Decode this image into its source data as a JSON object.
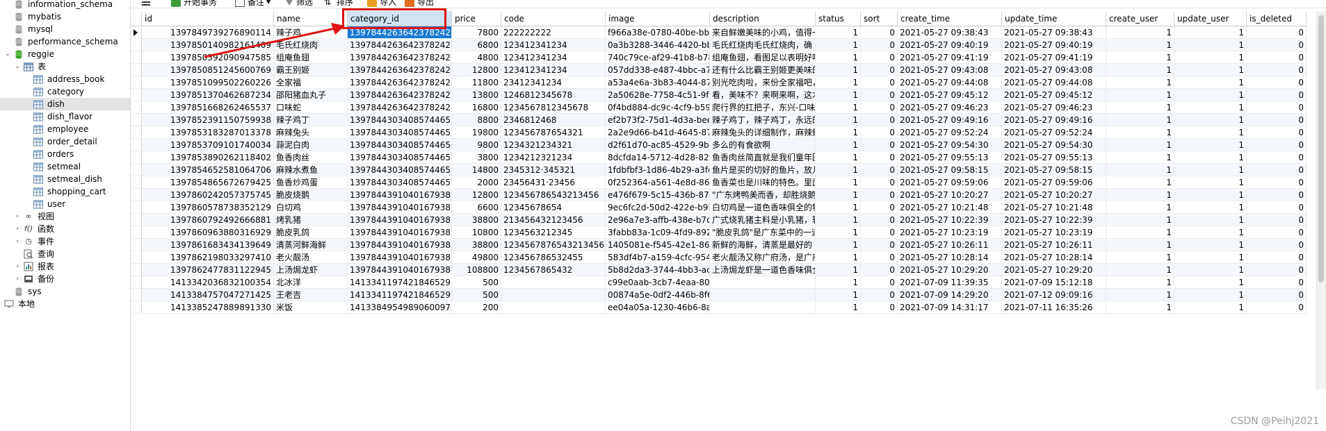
{
  "sidebar": {
    "items": [
      {
        "label": "information_schema",
        "kind": "db",
        "indent": 0,
        "expand": "",
        "open": false
      },
      {
        "label": "mybatis",
        "kind": "db",
        "indent": 0,
        "expand": "",
        "open": false
      },
      {
        "label": "mysql",
        "kind": "db",
        "indent": 0,
        "expand": "",
        "open": false
      },
      {
        "label": "performance_schema",
        "kind": "db",
        "indent": 0,
        "expand": "",
        "open": false
      },
      {
        "label": "reggie",
        "kind": "db",
        "indent": 0,
        "expand": "open",
        "open": true
      },
      {
        "label": "表",
        "kind": "tables",
        "indent": 1,
        "expand": "open",
        "open": true
      },
      {
        "label": "address_book",
        "kind": "table",
        "indent": 2,
        "expand": "",
        "open": false
      },
      {
        "label": "category",
        "kind": "table",
        "indent": 2,
        "expand": "",
        "open": false
      },
      {
        "label": "dish",
        "kind": "table",
        "indent": 2,
        "expand": "",
        "open": false,
        "selected": true
      },
      {
        "label": "dish_flavor",
        "kind": "table",
        "indent": 2,
        "expand": "",
        "open": false
      },
      {
        "label": "employee",
        "kind": "table",
        "indent": 2,
        "expand": "",
        "open": false
      },
      {
        "label": "order_detail",
        "kind": "table",
        "indent": 2,
        "expand": "",
        "open": false
      },
      {
        "label": "orders",
        "kind": "table",
        "indent": 2,
        "expand": "",
        "open": false
      },
      {
        "label": "setmeal",
        "kind": "table",
        "indent": 2,
        "expand": "",
        "open": false
      },
      {
        "label": "setmeal_dish",
        "kind": "table",
        "indent": 2,
        "expand": "",
        "open": false
      },
      {
        "label": "shopping_cart",
        "kind": "table",
        "indent": 2,
        "expand": "",
        "open": false
      },
      {
        "label": "user",
        "kind": "table",
        "indent": 2,
        "expand": "",
        "open": false
      },
      {
        "label": "视图",
        "kind": "views",
        "indent": 1,
        "expand": "closed",
        "open": false
      },
      {
        "label": "函数",
        "kind": "functions",
        "indent": 1,
        "expand": "closed",
        "open": false
      },
      {
        "label": "事件",
        "kind": "events",
        "indent": 1,
        "expand": "closed",
        "open": false
      },
      {
        "label": "查询",
        "kind": "queries",
        "indent": 1,
        "expand": "",
        "open": false
      },
      {
        "label": "报表",
        "kind": "reports",
        "indent": 1,
        "expand": "closed",
        "open": false
      },
      {
        "label": "备份",
        "kind": "backups",
        "indent": 1,
        "expand": "closed",
        "open": false
      },
      {
        "label": "sys",
        "kind": "db",
        "indent": 0,
        "expand": "",
        "open": false
      },
      {
        "label": "本地",
        "kind": "connection",
        "indent": -1,
        "expand": "",
        "open": false
      }
    ]
  },
  "toolbar": {
    "menu_icon": "menu-icon",
    "begin_transaction": "开始事务",
    "note": "备注",
    "filter": "筛选",
    "sort": "排序",
    "import": "导入",
    "export": "导出"
  },
  "grid": {
    "columns": [
      "id",
      "name",
      "category_id",
      "price",
      "code",
      "image",
      "description",
      "status",
      "sort",
      "create_time",
      "update_time",
      "create_user",
      "update_user",
      "is_deleted"
    ],
    "selected_column": "category_id",
    "rows": [
      [
        "1397849739276890114",
        "辣子鸡",
        "1397844263642378242",
        "7800",
        "222222222",
        "f966a38e-0780-40be-bb5",
        "来自鲜嫩美味的小鸡，值得一",
        "1",
        "0",
        "2021-05-27 09:38:43",
        "2021-05-27 09:38:43",
        "1",
        "1",
        "0"
      ],
      [
        "1397850140982161409",
        "毛氏红烧肉",
        "1397844263642378242",
        "6800",
        "123412341234",
        "0a3b3288-3446-4420-bbf",
        "毛氏红烧肉毛氏红烧肉，确",
        "1",
        "0",
        "2021-05-27 09:40:19",
        "2021-05-27 09:40:19",
        "1",
        "1",
        "0"
      ],
      [
        "1397850392090947585",
        "组庵鱼翅",
        "1397844263642378242",
        "4800",
        "123412341234",
        "740c79ce-af29-41b8-b78c",
        "组庵鱼翅，看图足以表明好吃",
        "1",
        "0",
        "2021-05-27 09:41:19",
        "2021-05-27 09:41:19",
        "1",
        "1",
        "0"
      ],
      [
        "1397850851245600769",
        "霸王别姬",
        "1397844263642378242",
        "12800",
        "123412341234",
        "057dd338-e487-4bbc-a74",
        "还有什么比霸王别姬更美味的",
        "1",
        "0",
        "2021-05-27 09:43:08",
        "2021-05-27 09:43:08",
        "1",
        "1",
        "0"
      ],
      [
        "1397851099502260226",
        "全家福",
        "1397844263642378242",
        "11800",
        "23412341234",
        "a53a4e6a-3b83-4044-87f",
        "别光吃肉啦，来份全家福吧，",
        "1",
        "0",
        "2021-05-27 09:44:08",
        "2021-05-27 09:44:08",
        "1",
        "1",
        "0"
      ],
      [
        "1397851370462687234",
        "邵阳猪血丸子",
        "1397844263642378242",
        "13800",
        "1246812345678",
        "2a50628e-7758-4c51-9fbl",
        "看，美味不？来啊来啊，这才",
        "1",
        "0",
        "2021-05-27 09:45:12",
        "2021-05-27 09:45:12",
        "1",
        "1",
        "0"
      ],
      [
        "1397851668262465537",
        "口味蛇",
        "1397844263642378242",
        "16800",
        "1234567812345678",
        "0f4bd884-dc9c-4cf9-b59e",
        "爬行界的扛把子，东兴-口味",
        "1",
        "0",
        "2021-05-27 09:46:23",
        "2021-05-27 09:46:23",
        "1",
        "1",
        "0"
      ],
      [
        "1397852391150759938",
        "辣子鸡丁",
        "1397844303408574465",
        "8800",
        "2346812468",
        "ef2b73f2-75d1-4d3a-beea",
        "辣子鸡丁，辣子鸡丁，永远的",
        "1",
        "0",
        "2021-05-27 09:49:16",
        "2021-05-27 09:49:16",
        "1",
        "1",
        "0"
      ],
      [
        "1397853183287013378",
        "麻辣兔头",
        "1397844303408574465",
        "19800",
        "123456787654321",
        "2a2e9d66-b41d-4645-87b",
        "麻辣兔头的详细制作，麻辣鲜",
        "1",
        "0",
        "2021-05-27 09:52:24",
        "2021-05-27 09:52:24",
        "1",
        "1",
        "0"
      ],
      [
        "1397853709101740034",
        "蒜泥白肉",
        "1397844303408574465",
        "9800",
        "1234321234321",
        "d2f61d70-ac85-4529-9b7",
        "多么的有食欲啊",
        "1",
        "0",
        "2021-05-27 09:54:30",
        "2021-05-27 09:54:30",
        "1",
        "1",
        "0"
      ],
      [
        "1397853890262118402",
        "鱼香肉丝",
        "1397844303408574465",
        "3800",
        "1234212321234",
        "8dcfda14-5712-4d28-82f",
        "鱼香肉丝简直就是我们童年回",
        "1",
        "0",
        "2021-05-27 09:55:13",
        "2021-05-27 09:55:13",
        "1",
        "1",
        "0"
      ],
      [
        "1397854652581064706",
        "麻辣水煮鱼",
        "1397844303408574465",
        "14800",
        "2345312·345321",
        "1fdbfbf3-1d86-4b29-a3fc",
        "鱼片是买的切好的鱼片，放几",
        "1",
        "0",
        "2021-05-27 09:58:15",
        "2021-05-27 09:58:15",
        "1",
        "1",
        "0"
      ],
      [
        "1397854865672679425",
        "鱼香炒鸡蛋",
        "1397844303408574465",
        "2000",
        "23456431·23456",
        "0f252364-a561-4e8d-866",
        "鱼香菜也是川味的特色。里面",
        "1",
        "0",
        "2021-05-27 09:59:06",
        "2021-05-27 09:59:06",
        "1",
        "1",
        "0"
      ],
      [
        "1397860242057375745",
        "脆皮烧鹅",
        "1397844391040167938",
        "12800",
        "123456786543213456",
        "e476f679-5c15-436b-87fa",
        "\"广东烤鸭美而香，却胜烧鹅",
        "1",
        "0",
        "2021-05-27 10:20:27",
        "2021-05-27 10:20:27",
        "1",
        "1",
        "0"
      ],
      [
        "1397860578738352129",
        "白切鸡",
        "1397844391040167938",
        "6600",
        "12345678654",
        "9ec6fc2d-50d2-422e-b954",
        "白切鸡是一道色香味俱全的特",
        "1",
        "0",
        "2021-05-27 10:21:48",
        "2021-05-27 10:21:48",
        "1",
        "1",
        "0"
      ],
      [
        "1397860792492666881",
        "烤乳猪",
        "1397844391040167938",
        "38800",
        "213456432123456",
        "2e96a7e3-affb-438e-b7c3",
        "广式烧乳猪主料是小乳猪，辅",
        "1",
        "0",
        "2021-05-27 10:22:39",
        "2021-05-27 10:22:39",
        "1",
        "1",
        "0"
      ],
      [
        "1397860963880316929",
        "脆皮乳鸽",
        "1397844391040167938",
        "10800",
        "1234563212345",
        "3fabb83a-1c09-4fd9-892k",
        "\"脆皮乳鸽\"是广东菜中的一道",
        "1",
        "0",
        "2021-05-27 10:23:19",
        "2021-05-27 10:23:19",
        "1",
        "1",
        "0"
      ],
      [
        "1397861683434139649",
        "清蒸河鲜海鲜",
        "1397844391040167938",
        "38800",
        "1234567876543213456",
        "1405081e-f545-42e1-86a2",
        "新鲜的海鲜，清蒸是最好的",
        "1",
        "0",
        "2021-05-27 10:26:11",
        "2021-05-27 10:26:11",
        "1",
        "1",
        "0"
      ],
      [
        "1397862198033297410",
        "老火靓汤",
        "1397844391040167938",
        "49800",
        "123456786532455",
        "583df4b7-a159-4cfc-9543",
        "老火靓汤又称广府汤，是广府",
        "1",
        "0",
        "2021-05-27 10:28:14",
        "2021-05-27 10:28:14",
        "1",
        "1",
        "0"
      ],
      [
        "1397862477831122945",
        "上汤焗龙虾",
        "1397844391040167938",
        "108800",
        "1234567865432",
        "5b8d2da3-3744-4bb3-acc",
        "上汤焗龙虾是一道色香味俱全",
        "1",
        "0",
        "2021-05-27 10:29:20",
        "2021-05-27 10:29:20",
        "1",
        "1",
        "0"
      ],
      [
        "1413342036832100354",
        "北冰洋",
        "1413341197421846529",
        "500",
        "",
        "c99e0aab-3cb7-4eaa-80f",
        "",
        "1",
        "0",
        "2021-07-09 11:39:35",
        "2021-07-09 15:12:18",
        "1",
        "1",
        "0"
      ],
      [
        "1413384757047271425",
        "王老吉",
        "1413341197421846529",
        "500",
        "",
        "00874a5e-0df2-446b-8f6",
        "",
        "1",
        "0",
        "2021-07-09 14:29:20",
        "2021-07-12 09:09:16",
        "1",
        "1",
        "0"
      ],
      [
        "1413385247889891330",
        "米饭",
        "1413384954989060097",
        "200",
        "",
        "ee04a05a-1230-46b6-8ad",
        "",
        "1",
        "0",
        "2021-07-09 14:31:17",
        "2021-07-11 16:35:26",
        "1",
        "1",
        "0"
      ]
    ]
  },
  "watermark": "CSDN @Peihj2021",
  "colors": {
    "annotation": "#e01515",
    "selection": "#1a7ad1",
    "header_selected": "#cfe3f5"
  }
}
